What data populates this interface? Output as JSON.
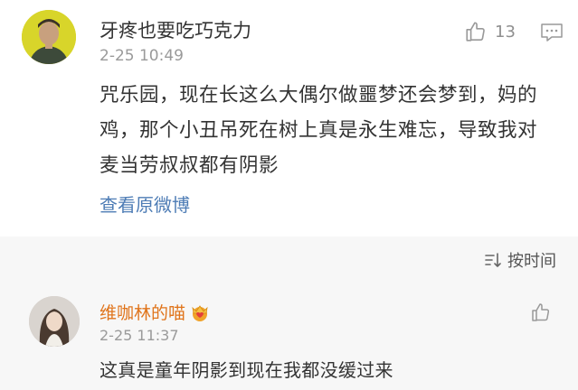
{
  "post": {
    "username": "牙疼也要吃巧克力",
    "time": "2-25 10:49",
    "like_count": "13",
    "text": "咒乐园，现在长这么大偶尔做噩梦还会梦到，妈的鸡，那个小丑吊死在树上真是永生难忘，导致我对麦当劳叔叔都有阴影",
    "view_original": "查看原微博"
  },
  "sort": {
    "label": "按时间"
  },
  "comment": {
    "username": "维咖林的喵",
    "time": "2-25 11:37",
    "text": "这真是童年阴影到现在我都没缓过来"
  },
  "colors": {
    "link": "#4d7cb5",
    "vip_name": "#e0741b",
    "meta": "#9a9a9a",
    "divider_bg": "#f7f7f7"
  }
}
